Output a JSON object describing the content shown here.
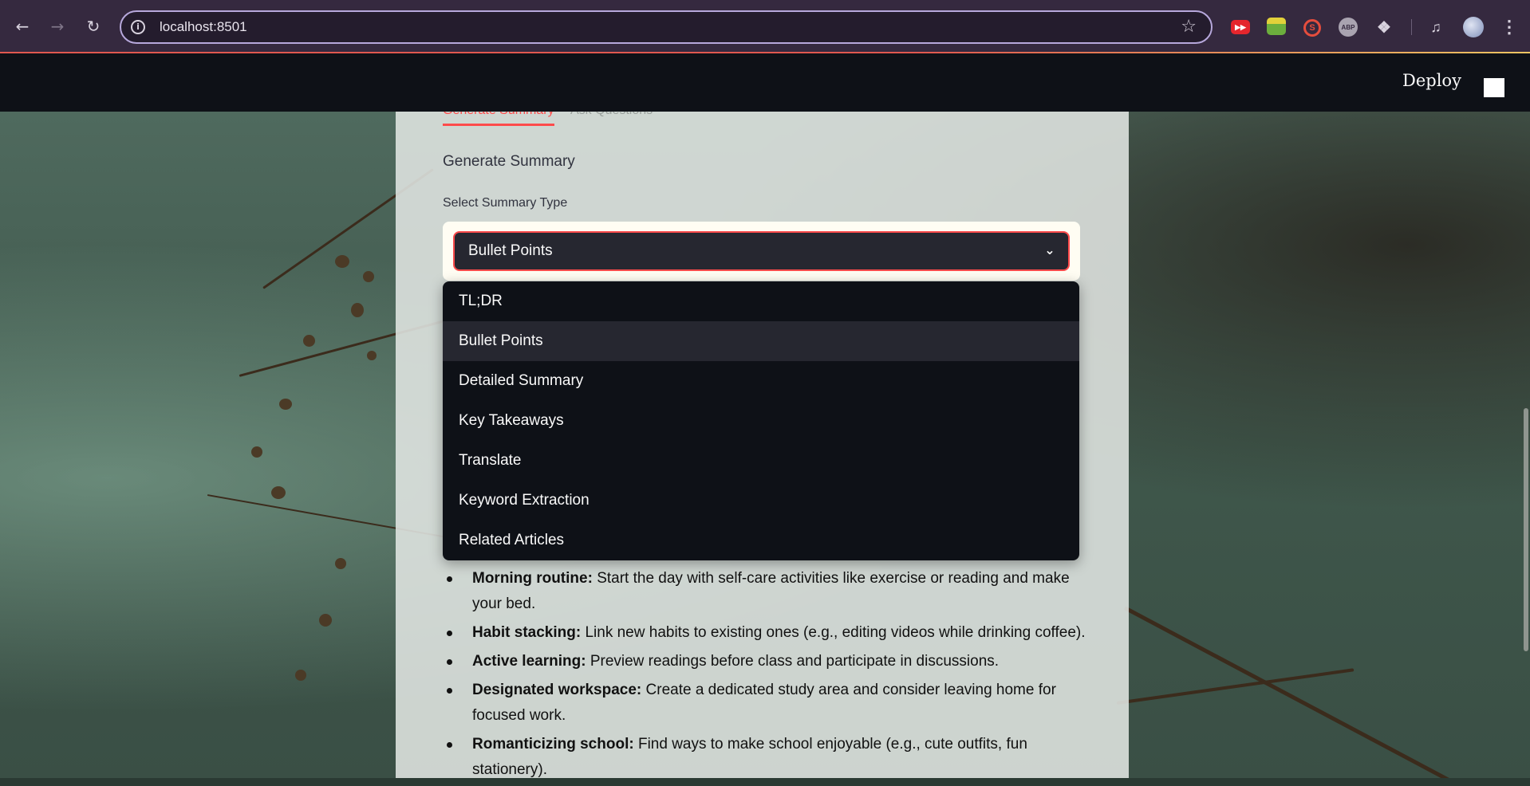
{
  "browser": {
    "url": "localhost:8501",
    "extensions": [
      "youtube-ext-icon",
      "green-ext-icon",
      "s-ext-icon",
      "abp-icon",
      "puzzle-icon",
      "media-control-icon",
      "profile-avatar",
      "kebab-menu-icon"
    ],
    "extension_labels": {
      "abp": "ABP",
      "s": "S"
    }
  },
  "header": {
    "deploy_label": "Deploy"
  },
  "tabs": [
    {
      "label": "Generate Summary",
      "active": true
    },
    {
      "label": "Ask Questions",
      "active": false
    }
  ],
  "main": {
    "heading": "Generate Summary",
    "select_label": "Select Summary Type",
    "selected_value": "Bullet Points"
  },
  "dropdown": {
    "options": [
      "TL;DR",
      "Bullet Points",
      "Detailed Summary",
      "Key Takeaways",
      "Translate",
      "Keyword Extraction",
      "Related Articles"
    ],
    "highlighted_index": 1
  },
  "summary_bullets": [
    {
      "title": "Morning routine:",
      "text": " Start the day with self-care activities like exercise or reading and make your bed."
    },
    {
      "title": "Habit stacking:",
      "text": " Link new habits to existing ones (e.g., editing videos while drinking coffee)."
    },
    {
      "title": "Active learning:",
      "text": " Preview readings before class and participate in discussions."
    },
    {
      "title": "Designated workspace:",
      "text": " Create a dedicated study area and consider leaving home for focused work."
    },
    {
      "title": "Romanticizing school:",
      "text": " Find ways to make school enjoyable (e.g., cute outfits, fun stationery)."
    }
  ],
  "colors": {
    "accent": "#ff4b4b",
    "header_bg": "#0e1117",
    "select_bg": "#262730"
  }
}
